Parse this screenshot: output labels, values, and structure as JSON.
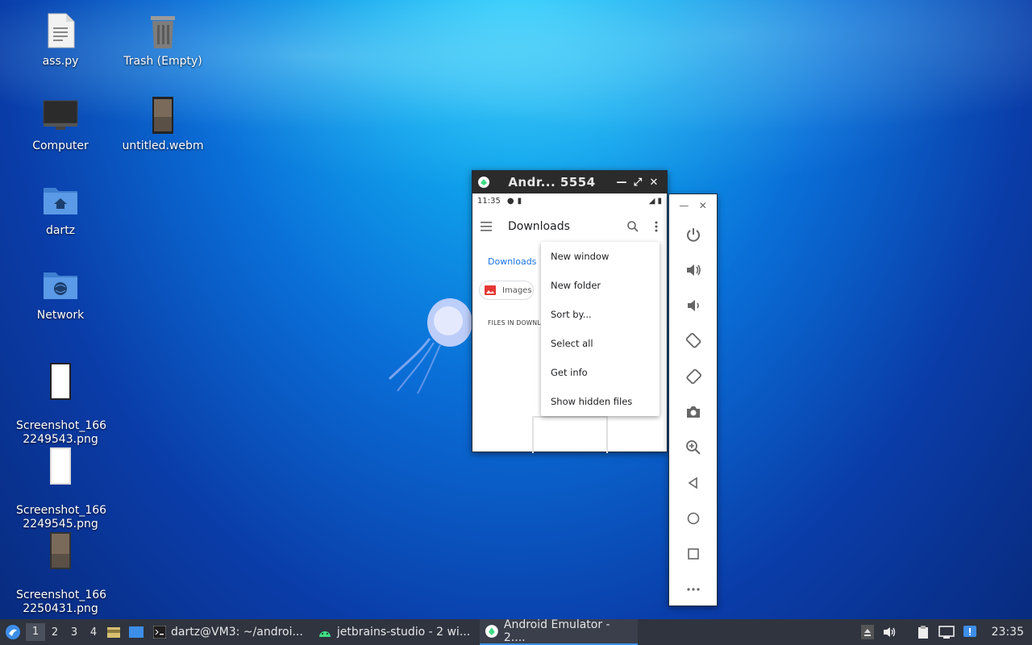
{
  "desktop": {
    "icons": [
      {
        "label": "ass.py"
      },
      {
        "label": "Trash (Empty)"
      },
      {
        "label": "Computer"
      },
      {
        "label": "untitled.webm"
      },
      {
        "label": "dartz"
      },
      {
        "label": "Network"
      },
      {
        "label": "Screenshot_166\n2249543.png"
      },
      {
        "label": "Screenshot_166\n2249545.png"
      },
      {
        "label": "Screenshot_166\n2250431.png"
      }
    ]
  },
  "emulator": {
    "title": "Andr... 5554",
    "status_time": "11:35",
    "appbar_title": "Downloads",
    "tab_label": "Downloads",
    "chip_label": "Images",
    "section_label": "FILES IN DOWNLO",
    "menu": [
      {
        "label": "New window"
      },
      {
        "label": "New folder"
      },
      {
        "label": "Sort by..."
      },
      {
        "label": "Select all"
      },
      {
        "label": "Get info"
      },
      {
        "label": "Show hidden files"
      }
    ]
  },
  "side_panel": {
    "buttons": [
      "power-icon",
      "volume-up-icon",
      "volume-down-icon",
      "rotate-left-icon",
      "rotate-right-icon",
      "camera-icon",
      "zoom-icon",
      "back-icon",
      "home-icon",
      "overview-icon",
      "more-icon"
    ]
  },
  "taskbar": {
    "workspaces": [
      "1",
      "2",
      "3",
      "4"
    ],
    "tasks": [
      {
        "label": "dartz@VM3: ~/androi..."
      },
      {
        "label": "jetbrains-studio - 2 wi..."
      },
      {
        "label": "Android Emulator - 2...."
      }
    ],
    "clock": "23:35"
  },
  "colors": {
    "accent": "#1a73e8",
    "taskbar_bg": "#2f343f",
    "active_task_underline": "#3d8ee8"
  }
}
